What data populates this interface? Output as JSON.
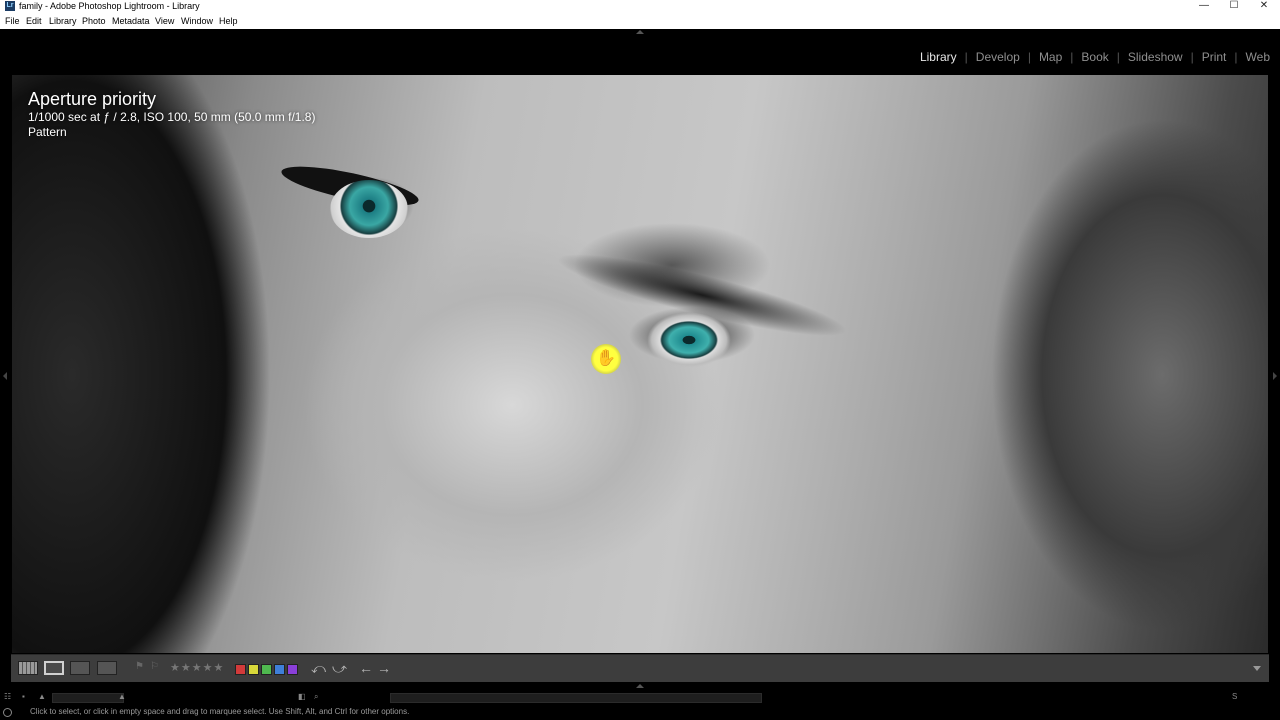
{
  "window": {
    "title": "family - Adobe Photoshop Lightroom - Library",
    "app_icon_text": "Lr",
    "minimize": "—",
    "maximize": "☐",
    "close": "✕"
  },
  "menu": [
    "File",
    "Edit",
    "Library",
    "Photo",
    "Metadata",
    "View",
    "Window",
    "Help"
  ],
  "modules": [
    "Library",
    "Develop",
    "Map",
    "Book",
    "Slideshow",
    "Print",
    "Web"
  ],
  "active_module": "Library",
  "photo_info": {
    "line1": "Aperture priority",
    "line2": "1/1000 sec at ƒ / 2.8, ISO 100, 50 mm (50.0 mm f/1.8)",
    "line3": "Pattern"
  },
  "toolbar": {
    "rating_stars": "★★★★★",
    "color_labels": [
      "#d23a3a",
      "#d8d83a",
      "#4fb84f",
      "#3f7fd9",
      "#8a3fd9"
    ]
  },
  "status": {
    "hint": "Click to select, or click in empty space and drag to marquee select. Use Shift, Alt, and Ctrl for other options."
  }
}
